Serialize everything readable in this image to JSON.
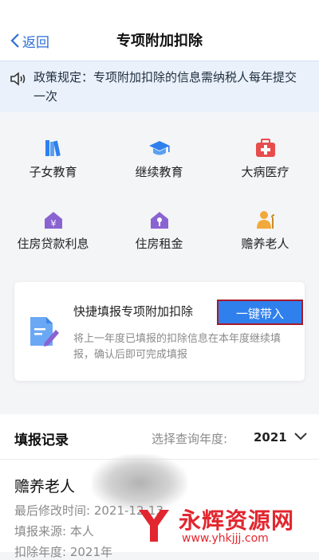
{
  "nav": {
    "back_label": "返回",
    "title": "专项附加扣除"
  },
  "notice": {
    "text": "政策规定：专项附加扣除的信息需纳税人每年提交一次"
  },
  "categories": [
    {
      "label": "子女教育",
      "icon": "books-icon"
    },
    {
      "label": "继续教育",
      "icon": "graduation-cap-icon"
    },
    {
      "label": "大病医疗",
      "icon": "medical-kit-icon"
    },
    {
      "label": "住房贷款利息",
      "icon": "house-yen-icon"
    },
    {
      "label": "住房租金",
      "icon": "house-key-icon"
    },
    {
      "label": "赡养老人",
      "icon": "elder-person-icon"
    }
  ],
  "quick": {
    "title": "快捷填报专项附加扣除",
    "button": "一键带入",
    "desc": "将上一年度已填报的扣除信息在本年度继续填报，确认后即可完成填报"
  },
  "records": {
    "header": "填报记录",
    "year_label": "选择查询年度:",
    "year_value": "2021",
    "item_title": "赡养老人",
    "rows": [
      "最后修改时间:  2021-12-13",
      "填报来源:  本人",
      "扣除年度:  2021年"
    ]
  },
  "watermark": {
    "brand": "永辉资源网",
    "url": "www.yhkjjj.com"
  },
  "colors": {
    "accent": "#2f80ed",
    "icon_purple": "#8a63d2",
    "watermark_red": "#e2262f"
  }
}
